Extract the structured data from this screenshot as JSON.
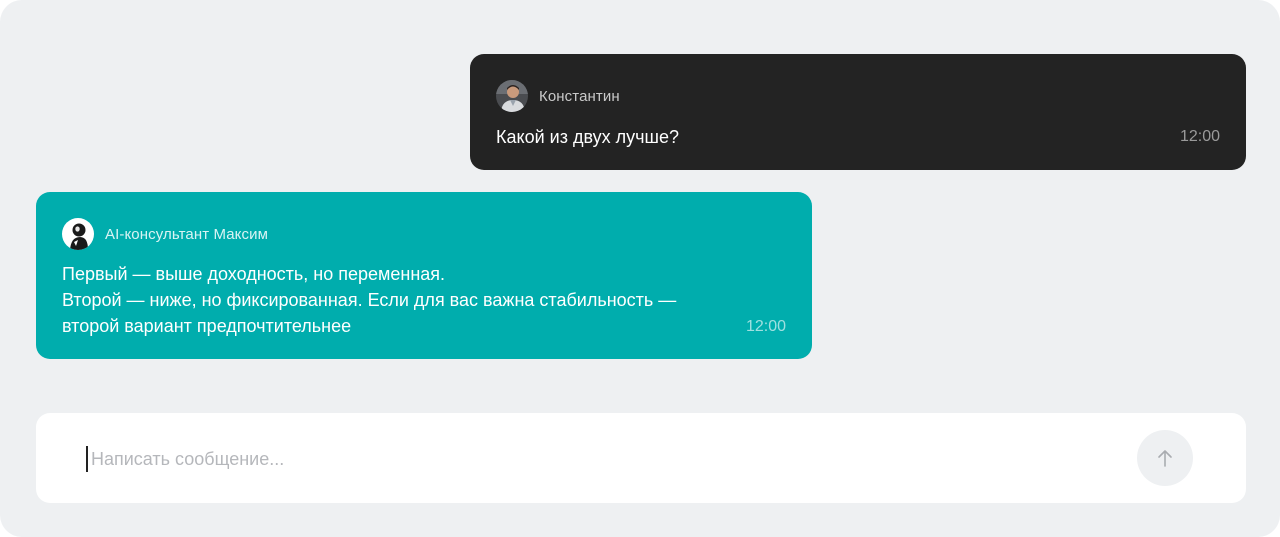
{
  "messages": {
    "user": {
      "sender": "Константин",
      "text": "Какой из двух лучше?",
      "time": "12:00"
    },
    "bot": {
      "sender": "AI-консультант Максим",
      "text": "Первый — выше доходность, но переменная.\nВторой — ниже, но фиксированная. Если для вас важна стабильность —\nвторой вариант предпочтительнее",
      "time": "12:00"
    }
  },
  "composer": {
    "placeholder": "Написать сообщение...",
    "send_icon": "arrow-up-icon"
  },
  "colors": {
    "panel_bg": "#eef0f2",
    "user_bubble": "#232323",
    "bot_bubble": "#00adad",
    "composer_bg": "#ffffff",
    "send_button_bg": "#eef0f2"
  }
}
